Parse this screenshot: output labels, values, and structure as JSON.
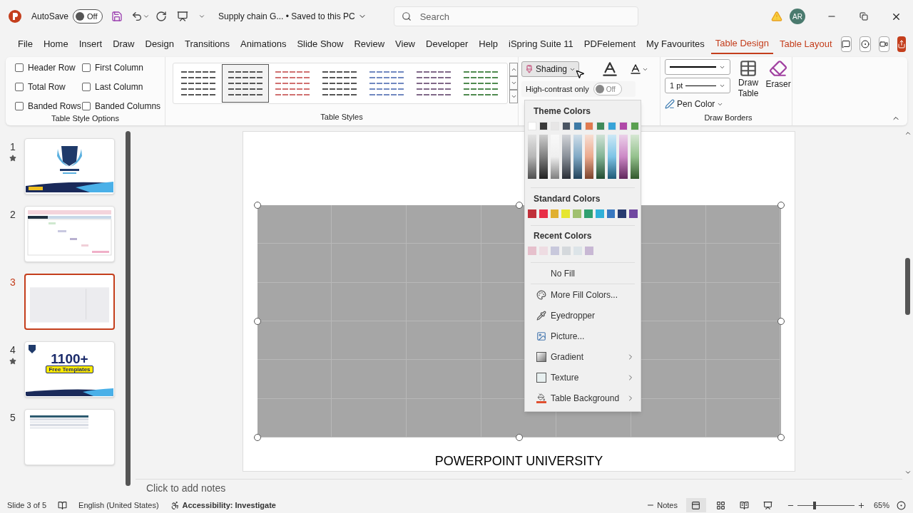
{
  "title_bar": {
    "autosave_label": "AutoSave",
    "autosave": {
      "label": "Off",
      "on": false
    },
    "document_title": "Supply chain G... • Saved to this PC",
    "search": {
      "placeholder": "Search"
    },
    "avatar": "AR"
  },
  "ribbon_tabs": [
    {
      "label": "File",
      "selected": false
    },
    {
      "label": "Home",
      "selected": false
    },
    {
      "label": "Insert",
      "selected": false
    },
    {
      "label": "Draw",
      "selected": false
    },
    {
      "label": "Design",
      "selected": false
    },
    {
      "label": "Transitions",
      "selected": false
    },
    {
      "label": "Animations",
      "selected": false
    },
    {
      "label": "Slide Show",
      "selected": false
    },
    {
      "label": "Review",
      "selected": false
    },
    {
      "label": "View",
      "selected": false
    },
    {
      "label": "Developer",
      "selected": false
    },
    {
      "label": "Help",
      "selected": false
    },
    {
      "label": "iSpring Suite 11",
      "selected": false
    },
    {
      "label": "PDFelement",
      "selected": false
    },
    {
      "label": "My Favourites",
      "selected": false
    },
    {
      "label": "Table Design",
      "selected": true
    },
    {
      "label": "Table Layout",
      "selected": false,
      "kind": "contextual"
    }
  ],
  "table_style_options": {
    "title": "Table Style Options",
    "options": [
      {
        "label": "Header Row",
        "checked": false
      },
      {
        "label": "First Column",
        "checked": false
      },
      {
        "label": "Total Row",
        "checked": false
      },
      {
        "label": "Last Column",
        "checked": false
      },
      {
        "label": "Banded Rows",
        "checked": false
      },
      {
        "label": "Banded Columns",
        "checked": false
      }
    ]
  },
  "table_styles": {
    "title": "Table Styles",
    "styles": [
      {
        "color": "#555555",
        "selected": false
      },
      {
        "color": "#555555",
        "selected": true
      },
      {
        "color": "#d07070",
        "selected": false
      },
      {
        "color": "#555555",
        "selected": false
      },
      {
        "color": "#7088c0",
        "selected": false
      },
      {
        "color": "#806888",
        "selected": false
      },
      {
        "color": "#4f8a4f",
        "selected": false
      }
    ]
  },
  "shading_button": "Shading",
  "high_contrast": {
    "label": "High-contrast only",
    "toggle": "Off",
    "on": false
  },
  "draw_borders": {
    "title": "Draw Borders",
    "line_weight": "1 pt",
    "pen_color": "Pen Color",
    "draw_table": "Draw Table",
    "eraser": "Eraser"
  },
  "shading_menu": {
    "theme_title": "Theme Colors",
    "theme_colors": [
      {
        "color": "#ffffff"
      },
      {
        "color": "#3a3a3a"
      },
      {
        "color": "#e7e6e6"
      },
      {
        "color": "#4a5462"
      },
      {
        "color": "#3d7aa6"
      },
      {
        "color": "#e07a50"
      },
      {
        "color": "#3f8a5a"
      },
      {
        "color": "#38a4d8"
      },
      {
        "color": "#b048a8"
      },
      {
        "color": "#5aa050"
      }
    ],
    "standard_title": "Standard Colors",
    "standard_colors": [
      {
        "color": "#c0303a"
      },
      {
        "color": "#e82e48"
      },
      {
        "color": "#e0b030"
      },
      {
        "color": "#e6e630"
      },
      {
        "color": "#a0c070"
      },
      {
        "color": "#30a070"
      },
      {
        "color": "#30b0d8"
      },
      {
        "color": "#3878c0"
      },
      {
        "color": "#283c70"
      },
      {
        "color": "#7048a0"
      }
    ],
    "recent_title": "Recent Colors",
    "recent_colors": [
      {
        "color": "#e6c0cc"
      },
      {
        "color": "#eedce2"
      },
      {
        "color": "#c8c8dc"
      },
      {
        "color": "#d4d8dc"
      },
      {
        "color": "#dce4e8"
      },
      {
        "color": "#c8b8d4"
      }
    ],
    "items": [
      {
        "label": "No Fill",
        "kind": "plain",
        "submenu": false
      },
      {
        "label": "More Fill Colors...",
        "kind": "palette",
        "submenu": false
      },
      {
        "label": "Eyedropper",
        "kind": "eyedropper",
        "submenu": false
      },
      {
        "label": "Picture...",
        "kind": "picture",
        "submenu": false
      },
      {
        "label": "Gradient",
        "kind": "gradient",
        "submenu": true
      },
      {
        "label": "Texture",
        "kind": "texture",
        "submenu": true
      },
      {
        "label": "Table Background",
        "kind": "bucket",
        "submenu": true
      }
    ]
  },
  "slides": [
    {
      "number": "1",
      "starred": true,
      "selected": false,
      "kind": "title"
    },
    {
      "number": "2",
      "starred": false,
      "selected": false,
      "kind": "gantt"
    },
    {
      "number": "3",
      "starred": false,
      "selected": true,
      "kind": "table"
    },
    {
      "number": "4",
      "starred": true,
      "selected": false,
      "kind": "promo",
      "headline": "1100+",
      "badge": "Free Templates"
    },
    {
      "number": "5",
      "starred": false,
      "selected": false,
      "kind": "list"
    }
  ],
  "slide": {
    "footer": "POWERPOINT UNIVERSITY"
  },
  "notes_placeholder": "Click to add notes",
  "status_bar": {
    "slide": "Slide 3 of 5",
    "language": "English (United States)",
    "accessibility": "Accessibility: Investigate",
    "notes": "Notes",
    "zoom": "65%",
    "zoom_slider": {
      "level": 0.3
    }
  }
}
